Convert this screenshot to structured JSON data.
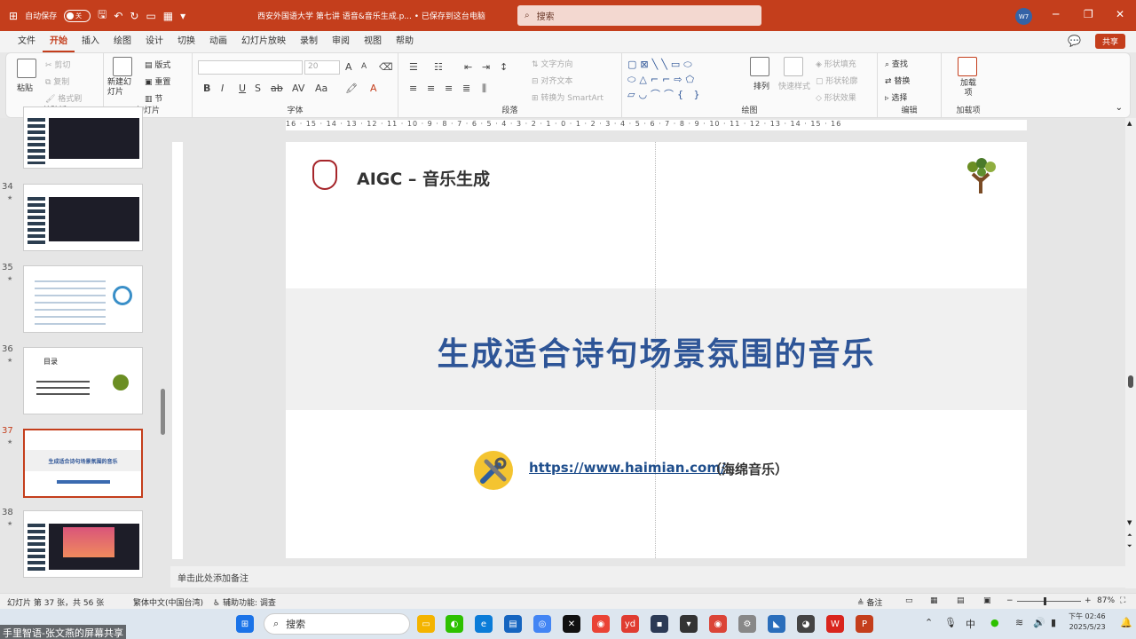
{
  "titlebar": {
    "autosave_label": "自动保存",
    "autosave_state": "关",
    "doc_title": "西安外国语大学 第七讲 语音&音乐生成.p... • 已保存到这台电脑",
    "search_placeholder": "搜索",
    "user_initials": "W7"
  },
  "menu": {
    "items": [
      "文件",
      "开始",
      "插入",
      "绘图",
      "设计",
      "切换",
      "动画",
      "幻灯片放映",
      "录制",
      "审阅",
      "视图",
      "帮助"
    ],
    "share_label": "共享"
  },
  "ribbon": {
    "clipboard": {
      "label": "剪贴板",
      "paste": "粘贴",
      "cut": "剪切",
      "copy": "复制",
      "format_painter": "格式刷"
    },
    "slides": {
      "label": "幻灯片",
      "new_slide": "新建幻灯片",
      "layout": "版式",
      "reset": "重置",
      "section": "节"
    },
    "font": {
      "label": "字体",
      "size": "20"
    },
    "paragraph": {
      "label": "段落",
      "text_direction": "文字方向",
      "align_text": "对齐文本",
      "smartart": "转换为 SmartArt"
    },
    "drawing": {
      "label": "绘图",
      "arrange": "排列",
      "quick_styles": "快速样式",
      "shape_fill": "形状填充",
      "shape_outline": "形状轮廓",
      "shape_effects": "形状效果"
    },
    "editing": {
      "label": "编辑",
      "find": "查找",
      "replace": "替换",
      "select": "选择"
    },
    "addins": {
      "label": "加载项",
      "addin": "加载项"
    }
  },
  "slides_panel": {
    "thumbs": [
      {
        "num": "",
        "kind": "dark"
      },
      {
        "num": "34",
        "kind": "dark"
      },
      {
        "num": "35",
        "kind": "list"
      },
      {
        "num": "36",
        "kind": "toc",
        "title": "目录"
      },
      {
        "num": "37",
        "kind": "current",
        "title": "生成适合诗句场景氛围的音乐"
      },
      {
        "num": "38",
        "kind": "image"
      }
    ]
  },
  "slide": {
    "heading": "AIGC – 音乐生成",
    "main_title": "生成适合诗句场景氛围的音乐",
    "link": "https://www.haimian.com/",
    "link_suffix": "（海绵音乐）"
  },
  "notes": {
    "placeholder": "单击此处添加备注"
  },
  "status": {
    "slide_info": "幻灯片 第 37 张，共 56 张",
    "language": "繁体中文(中国台湾)",
    "accessibility": "辅助功能: 调查",
    "notes_btn": "备注",
    "zoom": "87%"
  },
  "ruler": {
    "h_ticks": "16 · 15 · 14 · 13 · 12 · 11 · 10 · 9 · 8 · 7 · 6 · 5 · 4 · 3 · 2 · 1 · 0 · 1 · 2 · 3 · 4 · 5 · 6 · 7 · 8 · 9 · 10 · 11 · 12 · 13 · 14 · 15 · 16"
  },
  "taskbar": {
    "search": "搜索",
    "ime": "中",
    "time": "下午 02:46",
    "date": "2025/5/23"
  },
  "watermark": "手里智语-张文燕的屏幕共享",
  "colors": {
    "accent": "#c43e1c",
    "title_blue": "#2e5597",
    "link_blue": "#1f4e8c"
  }
}
